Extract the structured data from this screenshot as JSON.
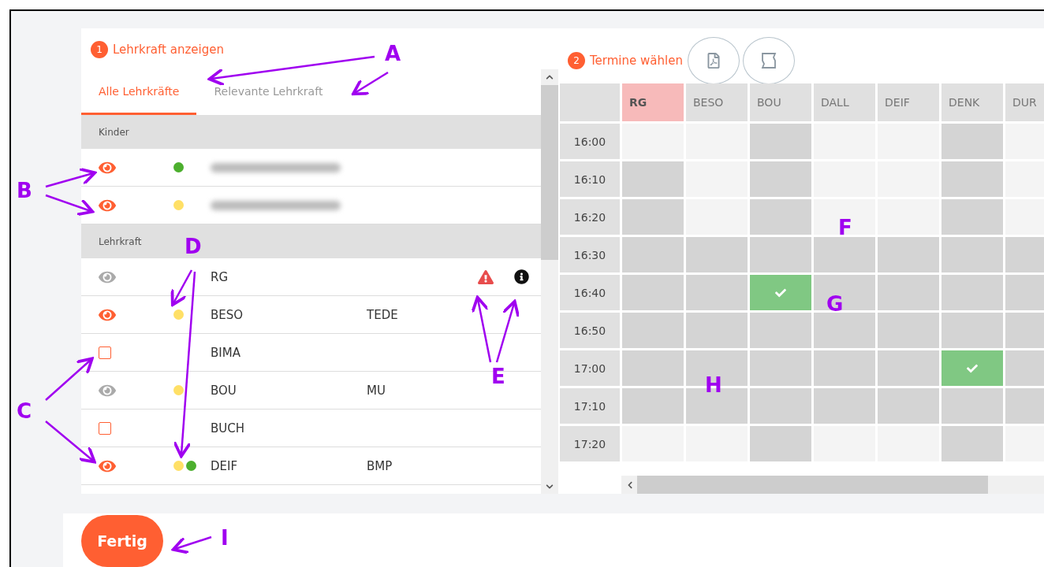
{
  "left_panel": {
    "step": "1",
    "title": "Lehrkraft anzeigen",
    "tabs": [
      {
        "label": "Alle Lehrkräfte",
        "selected": true
      },
      {
        "label": "Relevante Lehrkraft",
        "selected": false
      }
    ],
    "groups": [
      {
        "heading": "Kinder",
        "rows": [
          {
            "kind": "eye",
            "visible": true,
            "dots": [
              {
                "color": "#4caf2e"
              }
            ],
            "blurred": true
          },
          {
            "kind": "eye",
            "visible": true,
            "dots": [
              {
                "color": "#ffe066"
              }
            ],
            "blurred": true
          }
        ]
      },
      {
        "heading": "Lehrkraft",
        "rows": [
          {
            "kind": "eye",
            "visible": false,
            "dots": [],
            "name": "RG",
            "warning": true,
            "info": true
          },
          {
            "kind": "eye",
            "visible": true,
            "dots": [
              {
                "color": "#ffe066"
              }
            ],
            "name": "BESO",
            "subject": "TEDE"
          },
          {
            "kind": "checkbox",
            "checked": false,
            "dots": [],
            "name": "BIMA"
          },
          {
            "kind": "eye",
            "visible": false,
            "dots": [
              {
                "color": "#ffe066"
              }
            ],
            "name": "BOU",
            "subject": "MU"
          },
          {
            "kind": "checkbox",
            "checked": false,
            "dots": [],
            "name": "BUCH"
          },
          {
            "kind": "eye",
            "visible": true,
            "dots": [
              {
                "color": "#ffe066"
              },
              {
                "color": "#4caf2e"
              }
            ],
            "name": "DEIF",
            "subject": "BMP"
          }
        ]
      }
    ]
  },
  "right_panel": {
    "step": "2",
    "title": "Termine wählen",
    "columns": [
      {
        "label": "RG",
        "selected": true
      },
      {
        "label": "BESO",
        "selected": false
      },
      {
        "label": "BOU",
        "selected": false
      },
      {
        "label": "DALL",
        "selected": false
      },
      {
        "label": "DEIF",
        "selected": false
      },
      {
        "label": "DENK",
        "selected": false
      },
      {
        "label": "DUR",
        "selected": false
      }
    ],
    "rows": [
      {
        "time": "16:00",
        "cells": [
          {
            "available": true,
            "booked": false
          },
          {
            "available": true,
            "booked": false
          },
          {
            "available": false,
            "booked": false
          },
          {
            "available": true,
            "booked": false
          },
          {
            "available": true,
            "booked": false
          },
          {
            "available": false,
            "booked": false
          },
          {
            "available": true,
            "booked": false
          }
        ]
      },
      {
        "time": "16:10",
        "cells": [
          {
            "available": false,
            "booked": false
          },
          {
            "available": true,
            "booked": false
          },
          {
            "available": false,
            "booked": false
          },
          {
            "available": true,
            "booked": false
          },
          {
            "available": true,
            "booked": false
          },
          {
            "available": false,
            "booked": false
          },
          {
            "available": true,
            "booked": false
          }
        ]
      },
      {
        "time": "16:20",
        "cells": [
          {
            "available": false,
            "booked": false
          },
          {
            "available": true,
            "booked": false
          },
          {
            "available": false,
            "booked": false
          },
          {
            "available": true,
            "booked": false
          },
          {
            "available": true,
            "booked": false
          },
          {
            "available": false,
            "booked": false
          },
          {
            "available": true,
            "booked": false
          }
        ]
      },
      {
        "time": "16:30",
        "cells": [
          {
            "available": false,
            "booked": false
          },
          {
            "available": false,
            "booked": false
          },
          {
            "available": false,
            "booked": false
          },
          {
            "available": false,
            "booked": false
          },
          {
            "available": false,
            "booked": false
          },
          {
            "available": false,
            "booked": false
          },
          {
            "available": false,
            "booked": false
          }
        ]
      },
      {
        "time": "16:40",
        "cells": [
          {
            "available": false,
            "booked": false
          },
          {
            "available": false,
            "booked": false
          },
          {
            "available": false,
            "booked": true
          },
          {
            "available": false,
            "booked": false
          },
          {
            "available": false,
            "booked": false
          },
          {
            "available": false,
            "booked": false
          },
          {
            "available": false,
            "booked": false
          }
        ]
      },
      {
        "time": "16:50",
        "cells": [
          {
            "available": false,
            "booked": false
          },
          {
            "available": false,
            "booked": false
          },
          {
            "available": false,
            "booked": false
          },
          {
            "available": false,
            "booked": false
          },
          {
            "available": false,
            "booked": false
          },
          {
            "available": false,
            "booked": false
          },
          {
            "available": false,
            "booked": false
          }
        ]
      },
      {
        "time": "17:00",
        "cells": [
          {
            "available": false,
            "booked": false
          },
          {
            "available": false,
            "booked": false
          },
          {
            "available": false,
            "booked": false
          },
          {
            "available": false,
            "booked": false
          },
          {
            "available": false,
            "booked": false
          },
          {
            "available": false,
            "booked": true
          },
          {
            "available": false,
            "booked": false
          }
        ]
      },
      {
        "time": "17:10",
        "cells": [
          {
            "available": false,
            "booked": false
          },
          {
            "available": false,
            "booked": false
          },
          {
            "available": false,
            "booked": false
          },
          {
            "available": false,
            "booked": false
          },
          {
            "available": false,
            "booked": false
          },
          {
            "available": false,
            "booked": false
          },
          {
            "available": false,
            "booked": false
          }
        ]
      },
      {
        "time": "17:20",
        "cells": [
          {
            "available": true,
            "booked": false
          },
          {
            "available": true,
            "booked": false
          },
          {
            "available": false,
            "booked": false
          },
          {
            "available": true,
            "booked": false
          },
          {
            "available": true,
            "booked": false
          },
          {
            "available": false,
            "booked": false
          },
          {
            "available": true,
            "booked": false
          }
        ]
      }
    ]
  },
  "footer": {
    "button": "Fertig"
  },
  "annotations": [
    {
      "label": "A"
    },
    {
      "label": "B"
    },
    {
      "label": "C"
    },
    {
      "label": "D"
    },
    {
      "label": "E"
    },
    {
      "label": "F"
    },
    {
      "label": "G"
    },
    {
      "label": "H"
    },
    {
      "label": "I"
    }
  ]
}
